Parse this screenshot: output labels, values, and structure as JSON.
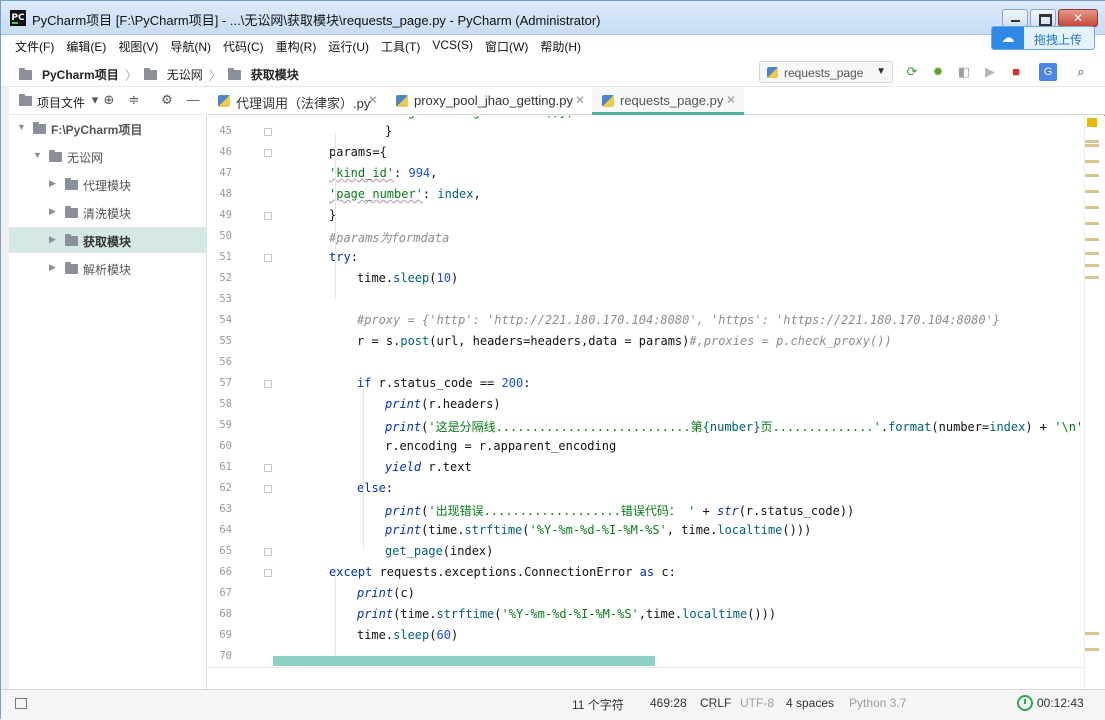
{
  "window": {
    "title": "PyCharm项目 [F:\\PyCharm项目] - ...\\无讼网\\获取模块\\requests_page.py - PyCharm (Administrator)",
    "app_icon_text": "PC",
    "close_symbol": "✕",
    "upload_label": "拖拽上传",
    "upload_icon": "cloud-icon"
  },
  "menu": [
    "文件(F)",
    "编辑(E)",
    "视图(V)",
    "导航(N)",
    "代码(C)",
    "重构(R)",
    "运行(U)",
    "工具(T)",
    "VCS(S)",
    "窗口(W)",
    "帮助(H)"
  ],
  "breadcrumb": [
    "PyCharm项目",
    "无讼网",
    "获取模块"
  ],
  "run_config": "requests_page",
  "toolbar_icons": [
    "rerun-icon",
    "debug-icon",
    "coverage-icon",
    "run-icon",
    "stop-icon",
    "translate-icon",
    "search-icon"
  ],
  "project_panel": {
    "label": "项目文件",
    "tree": [
      {
        "label": "F:\\PyCharm项目",
        "expanded": true,
        "bold": true
      },
      {
        "label": "无讼网",
        "expanded": true
      },
      {
        "label": "代理模块",
        "expanded": false
      },
      {
        "label": "清洗模块",
        "expanded": false
      },
      {
        "label": "获取模块",
        "expanded": false,
        "selected": true
      },
      {
        "label": "解析模块",
        "expanded": false
      }
    ]
  },
  "tabs": [
    {
      "label": "代理调用（法律家）.py",
      "active": false
    },
    {
      "label": "proxy_pool_jhao_getting.py",
      "active": false
    },
    {
      "label": "requests_page.py",
      "active": true
    }
  ],
  "editor": {
    "lines": [
      {
        "n": "45",
        "indent": 3,
        "parts": [
          [
            "}",
            "p"
          ]
        ]
      },
      {
        "n": "46",
        "indent": 1,
        "parts": [
          [
            "params={",
            "p"
          ]
        ]
      },
      {
        "n": "47",
        "indent": 1,
        "parts": [
          [
            "'kind_id'",
            "s"
          ],
          [
            ": ",
            "p"
          ],
          [
            "994",
            "num"
          ],
          [
            ",",
            "p"
          ]
        ]
      },
      {
        "n": "48",
        "indent": 1,
        "parts": [
          [
            "'page_number'",
            "s"
          ],
          [
            ": ",
            "p"
          ],
          [
            "index",
            "fn"
          ],
          [
            ",",
            "p"
          ]
        ]
      },
      {
        "n": "49",
        "indent": 1,
        "parts": [
          [
            "}",
            "p"
          ]
        ]
      },
      {
        "n": "50",
        "indent": 1,
        "parts": [
          [
            "#params为formdata",
            "c"
          ]
        ]
      },
      {
        "n": "51",
        "indent": 1,
        "parts": [
          [
            "try",
            "k"
          ],
          [
            ":",
            "p"
          ]
        ]
      },
      {
        "n": "52",
        "indent": 2,
        "parts": [
          [
            "time.",
            "p"
          ],
          [
            "sleep",
            "fn"
          ],
          [
            "(",
            "p"
          ],
          [
            "10",
            "num"
          ],
          [
            ")",
            "p"
          ]
        ]
      },
      {
        "n": "53",
        "indent": 0,
        "parts": []
      },
      {
        "n": "54",
        "indent": 2,
        "parts": [
          [
            "#proxy = {'http': 'http://221.180.170.104:8080', 'https': 'https://221.180.170.104:8080'}",
            "c"
          ]
        ]
      },
      {
        "n": "55",
        "indent": 2,
        "parts": [
          [
            "r = s.",
            "p"
          ],
          [
            "post",
            "fn"
          ],
          [
            "(url, headers=headers",
            "p"
          ],
          [
            ",",
            "p"
          ],
          [
            "data = params)",
            "p"
          ],
          [
            "#,proxies = p.check_proxy())",
            "c"
          ]
        ]
      },
      {
        "n": "56",
        "indent": 0,
        "parts": []
      },
      {
        "n": "57",
        "indent": 2,
        "parts": [
          [
            "if",
            "k"
          ],
          [
            " r.status_code == ",
            "p"
          ],
          [
            "200",
            "num"
          ],
          [
            ":",
            "p"
          ]
        ]
      },
      {
        "n": "58",
        "indent": 3,
        "parts": [
          [
            "print",
            "k"
          ],
          [
            "(r.headers)",
            "p"
          ]
        ]
      },
      {
        "n": "59",
        "indent": 3,
        "parts": [
          [
            "print",
            "k"
          ],
          [
            "(",
            "p"
          ],
          [
            "'这是分隔线...........................第",
            "s"
          ],
          [
            "{number}",
            "fn"
          ],
          [
            "页..............'",
            "s"
          ],
          [
            ".",
            "p"
          ],
          [
            "format",
            "fn"
          ],
          [
            "(number=",
            "p"
          ],
          [
            "index",
            "fn"
          ],
          [
            ") + ",
            "p"
          ],
          [
            "'\\n'",
            "s"
          ],
          [
            ")",
            "p"
          ]
        ]
      },
      {
        "n": "60",
        "indent": 3,
        "parts": [
          [
            "r.encoding = r.apparent_encoding",
            "p"
          ]
        ]
      },
      {
        "n": "61",
        "indent": 3,
        "parts": [
          [
            "yield",
            "k"
          ],
          [
            " r.text",
            "p"
          ]
        ]
      },
      {
        "n": "62",
        "indent": 2,
        "parts": [
          [
            "else",
            "k"
          ],
          [
            ":",
            "p"
          ]
        ]
      },
      {
        "n": "63",
        "indent": 3,
        "parts": [
          [
            "print",
            "k"
          ],
          [
            "(",
            "p"
          ],
          [
            "'出现错误...................错误代码： '",
            "s"
          ],
          [
            " + ",
            "p"
          ],
          [
            "str",
            "k"
          ],
          [
            "(r.status_code))",
            "p"
          ]
        ]
      },
      {
        "n": "64",
        "indent": 3,
        "parts": [
          [
            "print",
            "k"
          ],
          [
            "(time.",
            "p"
          ],
          [
            "strftime",
            "fn"
          ],
          [
            "(",
            "p"
          ],
          [
            "'%Y-%m-%d-%I-%M-%S'",
            "s"
          ],
          [
            ", time.",
            "p"
          ],
          [
            "localtime",
            "fn"
          ],
          [
            "()))",
            "p"
          ]
        ]
      },
      {
        "n": "65",
        "indent": 3,
        "parts": [
          [
            "get_page",
            "fn"
          ],
          [
            "(index)",
            "p"
          ]
        ]
      },
      {
        "n": "66",
        "indent": 1,
        "parts": [
          [
            "except",
            "k"
          ],
          [
            " requests.exceptions.ConnectionError ",
            "p"
          ],
          [
            "as",
            "k"
          ],
          [
            " c:",
            "p"
          ]
        ]
      },
      {
        "n": "67",
        "indent": 2,
        "parts": [
          [
            "print",
            "k"
          ],
          [
            "(c)",
            "p"
          ]
        ]
      },
      {
        "n": "68",
        "indent": 2,
        "parts": [
          [
            "print",
            "k"
          ],
          [
            "(time.",
            "p"
          ],
          [
            "strftime",
            "fn"
          ],
          [
            "(",
            "p"
          ],
          [
            "'%Y-%m-%d-%I-%M-%S'",
            "s"
          ],
          [
            ",",
            "p"
          ],
          [
            "time.",
            "p"
          ],
          [
            "localtime",
            "fn"
          ],
          [
            "()))",
            "p"
          ]
        ]
      },
      {
        "n": "69",
        "indent": 2,
        "parts": [
          [
            "time.",
            "p"
          ],
          [
            "sleep",
            "fn"
          ],
          [
            "(",
            "p"
          ],
          [
            "60",
            "num"
          ],
          [
            ")",
            "p"
          ]
        ]
      },
      {
        "n": "70",
        "indent": 0,
        "parts": []
      }
    ],
    "top_partial": "'User-Agent': u.getheaders()},"
  },
  "status_bar": {
    "chars": "11 个字符",
    "position": "469:28",
    "line_sep": "CRLF",
    "encoding": "UTF-8",
    "indent": "4 spaces",
    "interpreter": "Python 3.7",
    "time": "00:12:43"
  },
  "colors": {
    "keyword": "#0033b3",
    "function": "#00627a",
    "string": "#067d17",
    "number": "#1750eb",
    "comment": "#8c8c8c",
    "accent": "#4bb39e"
  }
}
